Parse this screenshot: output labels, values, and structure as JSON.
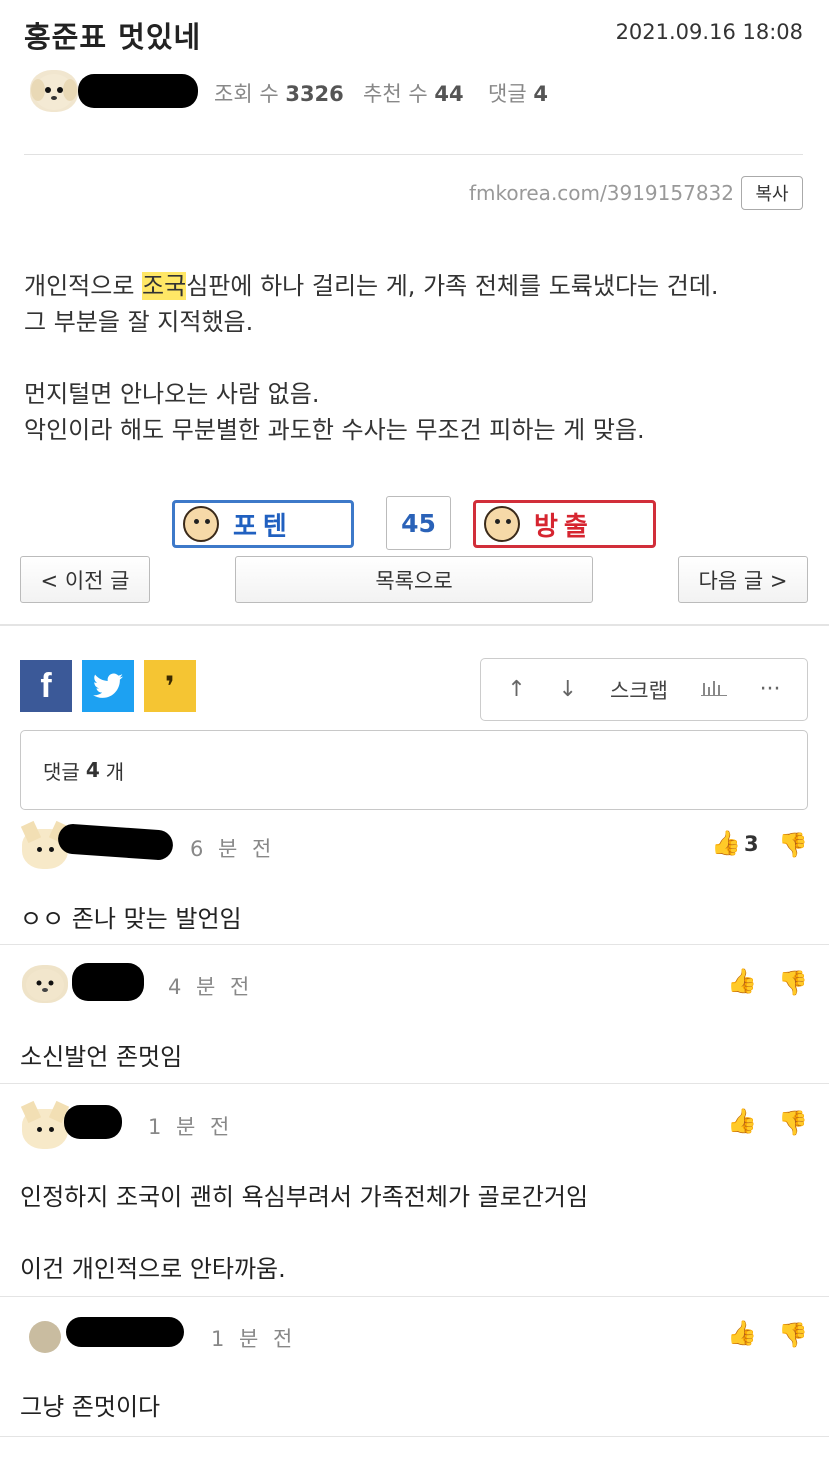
{
  "post": {
    "title": "홍준표 멋있네",
    "date": "2021.09.16 18:08",
    "views_label": "조회 수",
    "views": "3326",
    "recommend_label": "추천 수",
    "recommend": "44",
    "comments_label": "댓글",
    "comments": "4",
    "url": "fmkorea.com/3919157832",
    "copy_label": "복사",
    "body": {
      "line1_pre": "개인적으로 ",
      "line1_hl": "조국",
      "line1_post": "심판에 하나 걸리는 게, 가족 전체를 도륙냈다는 건데.",
      "line2": "그 부분을 잘 지적했음.",
      "line3": "먼지털면 안나오는 사람 없음.",
      "line4": "악인이라 해도 무분별한 과도한 수사는 무조건 피하는 게 맞음."
    }
  },
  "vote": {
    "up_label": "포텐",
    "count": "45",
    "down_label": "방출"
  },
  "nav": {
    "prev": "< 이전 글",
    "list": "목록으로",
    "next": "다음 글 >"
  },
  "share": {
    "facebook": "f",
    "twitter": "🐦",
    "kakao": "❜"
  },
  "tools": {
    "up": "↑",
    "down": "↓",
    "scrap": "스크랩",
    "stats": "📊",
    "more": "···"
  },
  "comment_header": {
    "prefix": "댓글",
    "count": "4",
    "suffix": "개"
  },
  "comments": [
    {
      "time": "6 분 전",
      "likes": "3",
      "text": "ㅇㅇ 존나 맞는 발언임",
      "text2": ""
    },
    {
      "time": "4 분 전",
      "likes": "",
      "text": "소신발언 존멋임",
      "text2": ""
    },
    {
      "time": "1 분 전",
      "likes": "",
      "text": "인정하지 조국이 괜히 욕심부려서 가족전체가 골로간거임",
      "text2": "이건 개인적으로 안타까움."
    },
    {
      "time": "1 분 전",
      "likes": "",
      "text": "그냥 존멋이다",
      "text2": ""
    }
  ],
  "icons": {
    "thumb_up": "👍",
    "thumb_down": "👎"
  }
}
